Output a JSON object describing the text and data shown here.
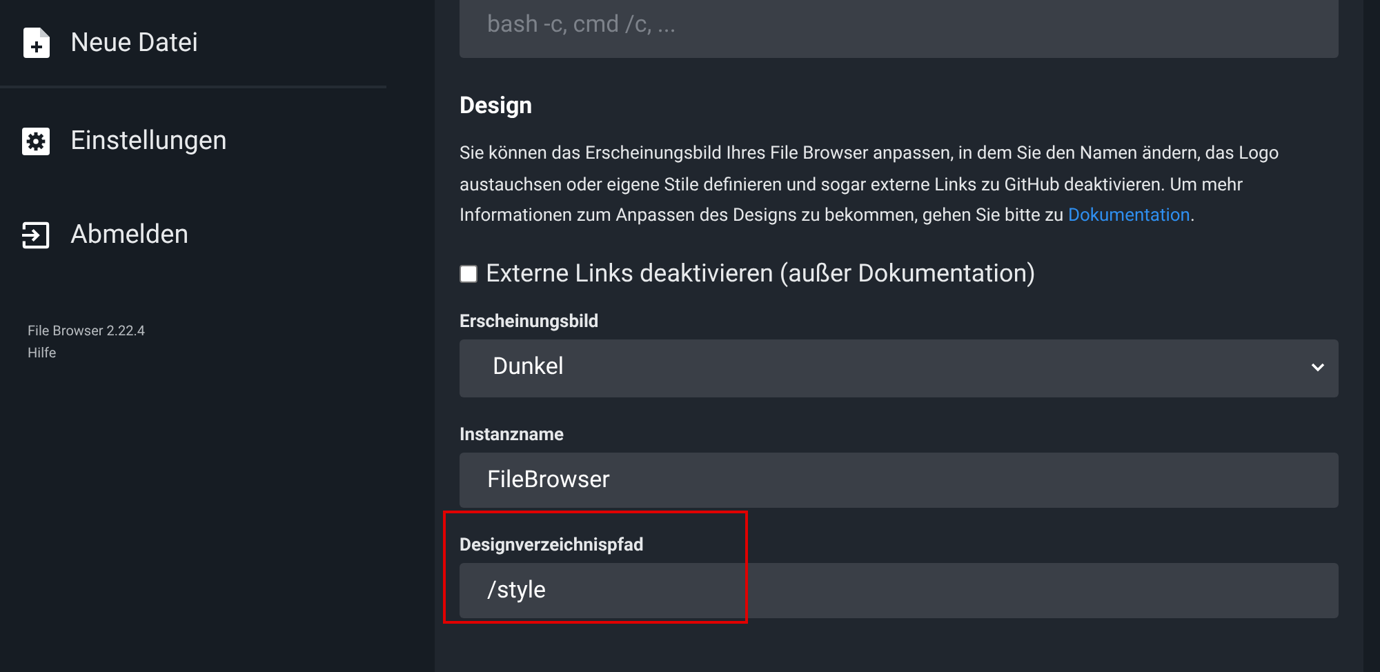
{
  "sidebar": {
    "items": [
      {
        "kind": "new-file",
        "label": "Neue Datei"
      },
      {
        "kind": "settings",
        "label": "Einstellungen"
      },
      {
        "kind": "logout",
        "label": "Abmelden"
      }
    ],
    "footer": [
      "File Browser 2.22.4",
      "Hilfe"
    ]
  },
  "command_field": {
    "placeholder": "bash -c, cmd /c, ..."
  },
  "design": {
    "title": "Design",
    "description": "Sie können das Erscheinungsbild Ihres File Browser anpassen, in dem Sie den Namen ändern, das Logo austauchsen oder eigene Stile definieren und sogar externe Links zu GitHub deaktivieren. Um mehr Informationen zum Anpassen des Designs zu bekommen, gehen Sie bitte zu",
    "link": "Dokumentation",
    "link_suffix": ".",
    "checkbox": {
      "label": "Externe Links deaktivieren (außer Dokumentation)",
      "checked": false
    },
    "fields": [
      {
        "kind": "select",
        "label": "Erscheinungsbild",
        "value": "Dunkel",
        "highlighted": false
      },
      {
        "kind": "text",
        "label": "Instanzname",
        "value": "FileBrowser",
        "highlighted": false
      },
      {
        "kind": "text",
        "label": "Designverzeichnispfad",
        "value": "/style",
        "highlighted": true
      }
    ]
  }
}
